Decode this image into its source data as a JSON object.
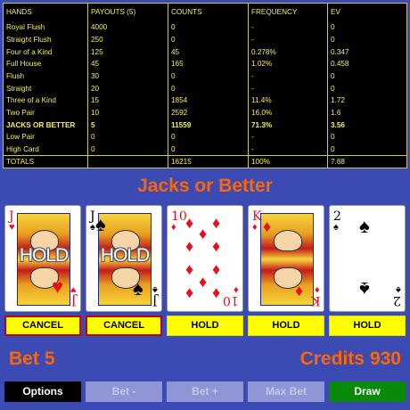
{
  "paytable": {
    "headers": [
      "HANDS",
      "PAYOUTS (5)",
      "COUNTS",
      "FREQUENCY",
      "EV"
    ],
    "rows": [
      [
        "Royal Flush",
        "4000",
        "0",
        "-",
        "0"
      ],
      [
        "Straight Flush",
        "250",
        "0",
        "-",
        "0"
      ],
      [
        "Four of a Kind",
        "125",
        "45",
        "0.278%",
        "0.347"
      ],
      [
        "Full House",
        "45",
        "165",
        "1.02%",
        "0.458"
      ],
      [
        "Flush",
        "30",
        "0",
        "-",
        "0"
      ],
      [
        "Straight",
        "20",
        "0",
        "-",
        "0"
      ],
      [
        "Three of a Kind",
        "15",
        "1854",
        "11.4%",
        "1.72"
      ],
      [
        "Two Pair",
        "10",
        "2592",
        "16.0%",
        "1.6"
      ],
      [
        "JACKS OR BETTER",
        "5",
        "11559",
        "71.3%",
        "3.56"
      ],
      [
        "Low Pair",
        "0",
        "0",
        "-",
        "0"
      ],
      [
        "High Card",
        "0",
        "0",
        "-",
        "0"
      ]
    ],
    "active_row": 8,
    "totals": [
      "TOTALS",
      "",
      "16215",
      "100%",
      "7.68"
    ]
  },
  "game_title": "Jacks or Better",
  "hold_overlay_text": "HOLD",
  "cards": [
    {
      "rank": "J",
      "suit": "♥",
      "color": "#e8101a",
      "held": true,
      "button": "CANCEL"
    },
    {
      "rank": "J",
      "suit": "♠",
      "color": "#000000",
      "held": true,
      "button": "CANCEL"
    },
    {
      "rank": "10",
      "suit": "♦",
      "color": "#e8101a",
      "held": false,
      "button": "HOLD"
    },
    {
      "rank": "K",
      "suit": "♦",
      "color": "#e8101a",
      "held": false,
      "button": "HOLD"
    },
    {
      "rank": "2",
      "suit": "♠",
      "color": "#000000",
      "held": false,
      "button": "HOLD"
    }
  ],
  "bet": {
    "label": "Bet",
    "value": "5"
  },
  "credits": {
    "label": "Credits",
    "value": "930"
  },
  "controls": {
    "options": "Options",
    "bet_minus": "Bet -",
    "bet_plus": "Bet +",
    "max_bet": "Max Bet",
    "draw": "Draw"
  },
  "colors": {
    "background": "#3c4ab4",
    "paytable_text": "#f4f05c",
    "title": "#ff6600",
    "hold_button": "#ffff00",
    "cancel_border": "#c00000",
    "draw_button": "#0a8a0a",
    "disabled_button": "#8e96d6"
  }
}
